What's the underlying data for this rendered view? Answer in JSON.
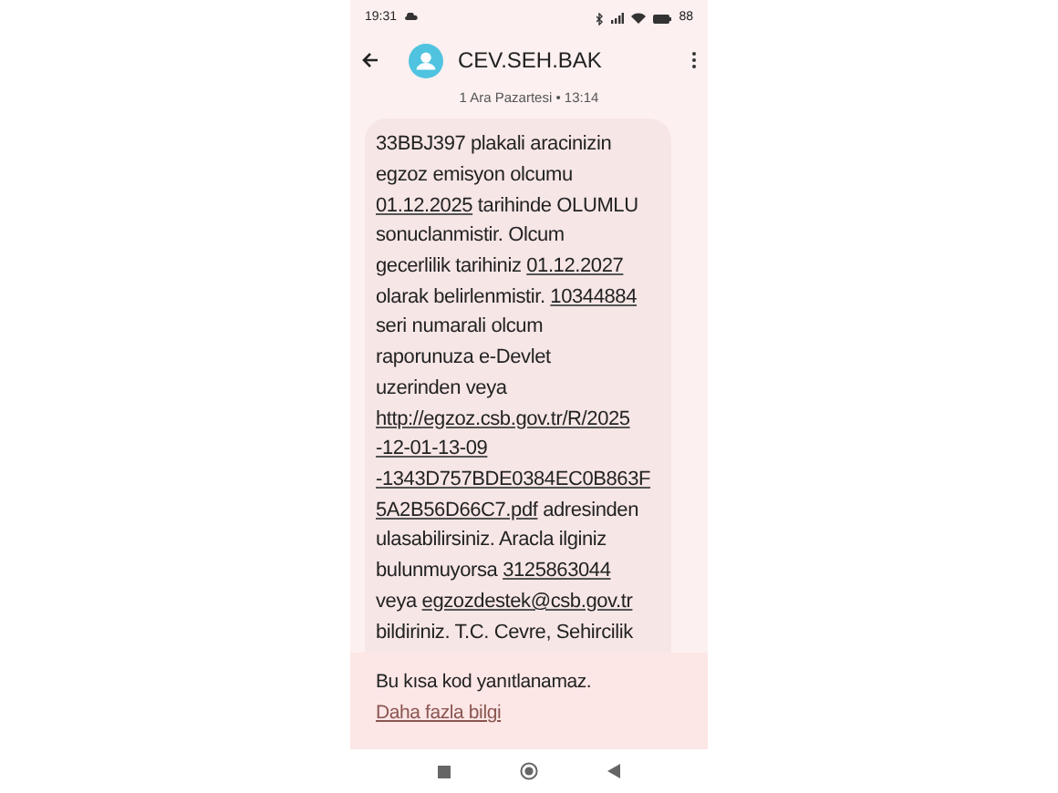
{
  "status_bar": {
    "time": "19:31",
    "battery": "88"
  },
  "header": {
    "title": "CEV.SEH.BAK"
  },
  "date_label": "1 Ara Pazartesi • 13:14",
  "message": {
    "lines": [
      [
        {
          "text": "33BBJ397 plakali aracinizin",
          "link": false
        }
      ],
      [
        {
          "text": "egzoz emisyon olcumu",
          "link": false
        }
      ],
      [
        {
          "text": "01.12.2025",
          "link": true
        },
        {
          "text": " tarihinde OLUMLU",
          "link": false
        }
      ],
      [
        {
          "text": "sonuclanmistir. Olcum",
          "link": false
        }
      ],
      [
        {
          "text": "gecerlilik tarihiniz ",
          "link": false
        },
        {
          "text": "01.12.2027",
          "link": true
        }
      ],
      [
        {
          "text": "olarak belirlenmistir. ",
          "link": false
        },
        {
          "text": "10344884",
          "link": true
        }
      ],
      [
        {
          "text": "seri numarali olcum",
          "link": false
        }
      ],
      [
        {
          "text": "raporunuza e-Devlet",
          "link": false
        }
      ],
      [
        {
          "text": "uzerinden veya",
          "link": false
        }
      ],
      [
        {
          "text": "http://egzoz.csb.gov.tr/R/2025",
          "link": true
        }
      ],
      [
        {
          "text": "-12-01-13-09",
          "link": true
        }
      ],
      [
        {
          "text": "-1343D757BDE0384EC0B863F",
          "link": true
        }
      ],
      [
        {
          "text": "5A2B56D66C7.pdf",
          "link": true
        },
        {
          "text": " adresinden",
          "link": false
        }
      ],
      [
        {
          "text": "ulasabilirsiniz. Aracla ilginiz",
          "link": false
        }
      ],
      [
        {
          "text": "bulunmuyorsa ",
          "link": false
        },
        {
          "text": "3125863044",
          "link": true
        }
      ],
      [
        {
          "text": "veya ",
          "link": false
        },
        {
          "text": "egzozdestek@csb.gov.tr",
          "link": true
        }
      ],
      [
        {
          "text": "bildiriniz. T.C. Cevre, Sehircilik",
          "link": false
        }
      ]
    ]
  },
  "footer": {
    "text": "Bu kısa kod yanıtlanamaz.",
    "link": "Daha fazla bilgi"
  }
}
